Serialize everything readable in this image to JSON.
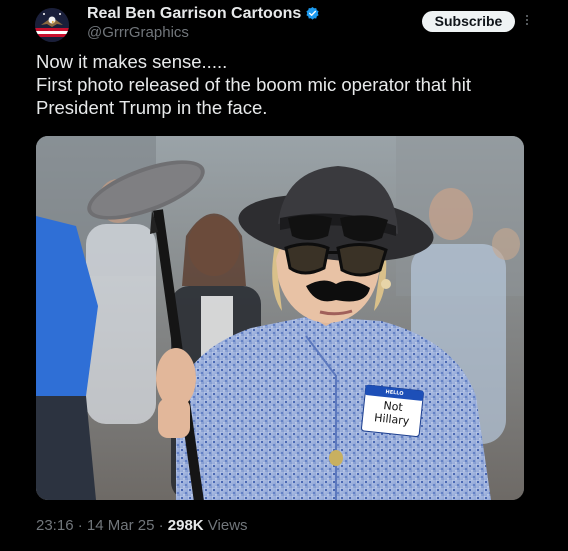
{
  "author": {
    "name": "Real Ben Garrison Cartoons",
    "handle": "@GrrrGraphics",
    "verified_icon": "verified-badge-icon",
    "avatar_icon": "avatar-eagle-flag-icon"
  },
  "actions": {
    "subscribe_label": "Subscribe",
    "more_icon": "more-options-icon"
  },
  "post": {
    "text_lines": [
      "Now it makes sense.....",
      "First photo released of the boom mic operator that hit",
      "President Trump in the face."
    ]
  },
  "media": {
    "name_tag": {
      "header": "HELLO",
      "line1": "Not",
      "line2": "Hillary"
    }
  },
  "meta": {
    "time": "23:16",
    "sep1": " · ",
    "date": "14 Mar 25",
    "sep2": " · ",
    "views_count": "298K",
    "views_label": " Views"
  },
  "colors": {
    "background": "#000000",
    "text_primary": "#e7e9ea",
    "text_secondary": "#71767b",
    "verified_blue": "#1d9bf0",
    "button_bg": "#eff3f4"
  }
}
